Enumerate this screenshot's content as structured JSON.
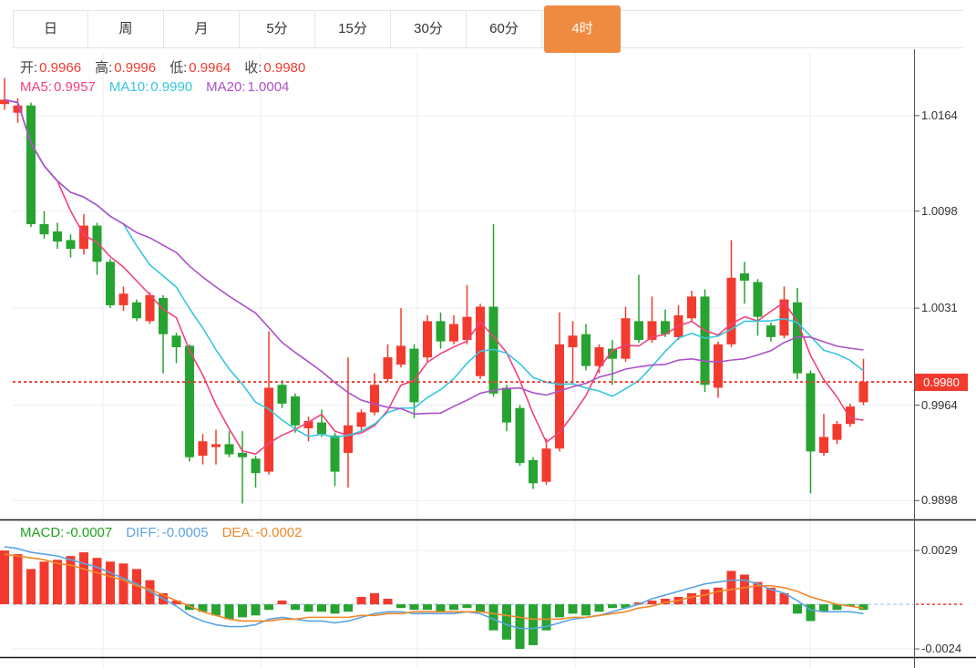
{
  "tabbar": {
    "tabs": [
      {
        "label": "日"
      },
      {
        "label": "周"
      },
      {
        "label": "月"
      },
      {
        "label": "5分"
      },
      {
        "label": "15分"
      },
      {
        "label": "30分"
      },
      {
        "label": "60分"
      },
      {
        "label": "4时"
      }
    ],
    "active_index": 7
  },
  "legend": {
    "ohlc": [
      {
        "label": "开:",
        "value": "0.9966"
      },
      {
        "label": "高:",
        "value": "0.9996"
      },
      {
        "label": "低:",
        "value": "0.9964"
      },
      {
        "label": "收:",
        "value": "0.9980"
      }
    ],
    "ma": [
      {
        "label": "MA5:",
        "value": "0.9957",
        "color_key": "ma5_pink"
      },
      {
        "label": "MA10:",
        "value": "0.9990",
        "color_key": "ma10_cyan"
      },
      {
        "label": "MA20:",
        "value": "1.0004",
        "color_key": "ma20_purple"
      }
    ],
    "macd": [
      {
        "label": "MACD:",
        "value": "-0.0007",
        "color_key": "macd_green"
      },
      {
        "label": "DIFF:",
        "value": "-0.0005",
        "color_key": "diff_blue"
      },
      {
        "label": "DEA:",
        "value": "-0.0002",
        "color_key": "dea_orange"
      }
    ]
  },
  "price_line": {
    "value": 0.998,
    "label": "0.9980"
  },
  "colors": {
    "accent_orange": "#ef8b41",
    "up_red": "#f23b2e",
    "down_green": "#26a330",
    "ma5_pink": "#f0437e",
    "ma10_cyan": "#36c6e0",
    "ma20_purple": "#ab52c8",
    "diff_blue": "#5ba4e5",
    "dea_orange": "#f08828",
    "macd_green": "#21a21f",
    "price_tag_bg": "#f23b2e",
    "grid": "#e9eef5",
    "zero_dash_blue": "#aed6ec",
    "divider": "#1a1a1a",
    "axis_line": "#555",
    "text_dark": "#444",
    "axis_text": "#333"
  },
  "chart_data": [
    {
      "type": "candlestick",
      "title": "K-line main panel (4-hour bars, Chinese convention: red=up, green=down)",
      "y_ticks": [
        1.0164,
        1.0098,
        1.0031,
        0.9964,
        0.9898
      ],
      "ylim": [
        0.9885,
        1.0208
      ],
      "x_gridlines": [
        113,
        286,
        458,
        631,
        889
      ],
      "last_price": 0.998,
      "ma_periods": [
        5,
        10,
        20
      ],
      "candles": [
        [
          1.0172,
          1.019,
          1.0168,
          1.0175
        ],
        [
          1.0166,
          1.0176,
          1.0159,
          1.0171
        ],
        [
          1.0171,
          1.0173,
          1.0087,
          1.0089
        ],
        [
          1.0089,
          1.0098,
          1.0079,
          1.0082
        ],
        [
          1.0084,
          1.009,
          1.0072,
          1.0077
        ],
        [
          1.0078,
          1.0082,
          1.0066,
          1.0072
        ],
        [
          1.0072,
          1.0096,
          1.0068,
          1.0088
        ],
        [
          1.0088,
          1.009,
          1.0054,
          1.0063
        ],
        [
          1.0063,
          1.0065,
          1.0031,
          1.0033
        ],
        [
          1.0033,
          1.0046,
          1.0029,
          1.0041
        ],
        [
          1.0035,
          1.0037,
          1.0022,
          1.0024
        ],
        [
          1.0022,
          1.0042,
          1.002,
          1.004
        ],
        [
          1.0038,
          1.004,
          0.9986,
          1.0013
        ],
        [
          1.0012,
          1.0014,
          0.9993,
          1.0004
        ],
        [
          1.0005,
          1.0006,
          0.9925,
          0.9928
        ],
        [
          0.9929,
          0.9944,
          0.9923,
          0.9939
        ],
        [
          0.9935,
          0.9947,
          0.9923,
          0.9937
        ],
        [
          0.9937,
          0.9946,
          0.9928,
          0.993
        ],
        [
          0.9931,
          0.9946,
          0.9896,
          0.9928
        ],
        [
          0.9927,
          0.9929,
          0.9907,
          0.9917
        ],
        [
          0.9918,
          1.0015,
          0.9916,
          0.9976
        ],
        [
          0.9978,
          0.9981,
          0.9962,
          0.9965
        ],
        [
          0.997,
          0.9972,
          0.9945,
          0.995
        ],
        [
          0.9948,
          0.9956,
          0.9939,
          0.9953
        ],
        [
          0.9952,
          0.9961,
          0.9942,
          0.9944
        ],
        [
          0.9943,
          0.9945,
          0.9908,
          0.9918
        ],
        [
          0.9931,
          0.9997,
          0.9907,
          0.995
        ],
        [
          0.9949,
          0.9961,
          0.9946,
          0.9959
        ],
        [
          0.9959,
          0.9986,
          0.9957,
          0.9978
        ],
        [
          0.9982,
          1.0006,
          0.998,
          0.9997
        ],
        [
          0.9992,
          1.0031,
          0.999,
          1.0005
        ],
        [
          1.0003,
          1.0006,
          0.9955,
          0.9966
        ],
        [
          0.9997,
          1.0026,
          0.9994,
          1.0022
        ],
        [
          1.0022,
          1.0028,
          1.0003,
          1.0008
        ],
        [
          1.0008,
          1.0026,
          1.0006,
          1.002
        ],
        [
          1.0009,
          1.0047,
          1.0006,
          1.0025
        ],
        [
          0.9984,
          1.0034,
          0.9982,
          1.0032
        ],
        [
          1.0032,
          1.0089,
          0.997,
          0.9972
        ],
        [
          0.9976,
          0.9978,
          0.9946,
          0.9952
        ],
        [
          0.9962,
          0.9964,
          0.9922,
          0.9924
        ],
        [
          0.9926,
          0.9928,
          0.9906,
          0.991
        ],
        [
          0.9911,
          0.9941,
          0.9909,
          0.9934
        ],
        [
          0.9934,
          1.0028,
          0.9932,
          1.0006
        ],
        [
          1.0004,
          1.0022,
          0.9978,
          1.0012
        ],
        [
          1.0013,
          1.002,
          0.9988,
          0.9991
        ],
        [
          0.9991,
          1.0006,
          0.9986,
          1.0004
        ],
        [
          1.0003,
          1.0009,
          0.9978,
          0.9996
        ],
        [
          0.9996,
          1.0032,
          0.9994,
          1.0024
        ],
        [
          1.0022,
          1.0054,
          1.0007,
          1.0009
        ],
        [
          1.0009,
          1.0039,
          1.0007,
          1.0022
        ],
        [
          1.0022,
          1.003,
          1.0011,
          1.0013
        ],
        [
          1.0011,
          1.0033,
          1.0009,
          1.0026
        ],
        [
          1.0024,
          1.0043,
          1.0022,
          1.0039
        ],
        [
          1.0039,
          1.0044,
          0.9973,
          0.9978
        ],
        [
          0.9976,
          1.0008,
          0.9969,
          1.0006
        ],
        [
          1.0006,
          1.0078,
          1.0004,
          1.0052
        ],
        [
          1.0055,
          1.0063,
          1.0034,
          1.005
        ],
        [
          1.0049,
          1.0051,
          1.0012,
          1.0025
        ],
        [
          1.0019,
          1.0021,
          1.0008,
          1.0011
        ],
        [
          1.0012,
          1.0046,
          1.001,
          1.0037
        ],
        [
          1.0035,
          1.0045,
          0.9982,
          0.9986
        ],
        [
          0.9986,
          0.9988,
          0.9903,
          0.9932
        ],
        [
          0.9931,
          0.9958,
          0.9929,
          0.9942
        ],
        [
          0.994,
          0.9953,
          0.9937,
          0.9951
        ],
        [
          0.9951,
          0.9965,
          0.9949,
          0.9963
        ],
        [
          0.9966,
          0.9996,
          0.9964,
          0.998
        ]
      ]
    },
    {
      "type": "bar",
      "title": "MACD panel",
      "y_ticks": [
        0.0029,
        -0.0024
      ],
      "ylim": [
        -0.00284,
        0.00452
      ],
      "hist": [
        0.0029,
        0.0027,
        0.0019,
        0.0023,
        0.0024,
        0.0026,
        0.0028,
        0.0025,
        0.0023,
        0.0022,
        0.0019,
        0.0013,
        0.0006,
        0.0002,
        -0.0003,
        -0.0004,
        -0.0006,
        -0.0008,
        -0.0007,
        -0.0006,
        -0.0003,
        0.0002,
        -0.0003,
        -0.0004,
        -0.0004,
        -0.0005,
        -0.0004,
        0.0004,
        0.0006,
        0.0003,
        -0.0002,
        -0.0003,
        -0.0003,
        -0.0004,
        -0.0003,
        -0.0002,
        -0.0004,
        -0.0014,
        -0.0019,
        -0.0024,
        -0.0022,
        -0.0014,
        -0.0007,
        -0.0005,
        -0.0006,
        -0.0004,
        -0.0002,
        -0.0002,
        0.0001,
        0.0002,
        0.0003,
        0.0004,
        0.0006,
        0.0008,
        0.0009,
        0.0018,
        0.0016,
        0.0012,
        0.0009,
        0.0006,
        -0.0005,
        -0.0009,
        -0.0004,
        -0.0003,
        -0.0001,
        -0.0003
      ],
      "diff": [
        0.0031,
        0.003,
        0.0028,
        0.0027,
        0.0026,
        0.0024,
        0.0022,
        0.002,
        0.0017,
        0.0014,
        0.0011,
        0.0007,
        0.0003,
        -0.0001,
        -0.0006,
        -0.0009,
        -0.0011,
        -0.0012,
        -0.0012,
        -0.0011,
        -0.0008,
        -0.0007,
        -0.0008,
        -0.0009,
        -0.0009,
        -0.001,
        -0.0009,
        -0.0007,
        -0.0005,
        -0.0004,
        -0.0004,
        -0.0005,
        -0.0005,
        -0.0005,
        -0.0005,
        -0.0004,
        -0.0005,
        -0.0008,
        -0.0011,
        -0.0013,
        -0.0013,
        -0.0012,
        -0.001,
        -0.0008,
        -0.0007,
        -0.0006,
        -0.0004,
        -0.0002,
        0.0,
        0.0003,
        0.0005,
        0.0007,
        0.0009,
        0.0011,
        0.0012,
        0.0013,
        0.0013,
        0.0011,
        0.0008,
        0.0006,
        0.0002,
        -0.0003,
        -0.0004,
        -0.0004,
        -0.0004,
        -0.0005
      ],
      "dea": [
        0.0027,
        0.0026,
        0.0025,
        0.0024,
        0.0022,
        0.0021,
        0.0019,
        0.0017,
        0.0015,
        0.0013,
        0.001,
        0.0008,
        0.0005,
        0.0002,
        -0.0001,
        -0.0004,
        -0.0006,
        -0.0008,
        -0.0009,
        -0.0009,
        -0.0009,
        -0.0008,
        -0.0008,
        -0.0007,
        -0.0007,
        -0.0007,
        -0.0007,
        -0.0006,
        -0.0006,
        -0.0005,
        -0.0005,
        -0.0004,
        -0.0004,
        -0.0004,
        -0.0004,
        -0.0004,
        -0.0004,
        -0.0005,
        -0.0006,
        -0.0007,
        -0.0008,
        -0.0008,
        -0.0008,
        -0.0007,
        -0.0007,
        -0.0006,
        -0.0005,
        -0.0004,
        -0.0002,
        -0.0001,
        0.0001,
        0.0002,
        0.0004,
        0.0005,
        0.0007,
        0.0008,
        0.0009,
        0.001,
        0.001,
        0.0009,
        0.0007,
        0.0004,
        0.0002,
        0.0,
        -0.0001,
        -0.0002
      ]
    }
  ]
}
